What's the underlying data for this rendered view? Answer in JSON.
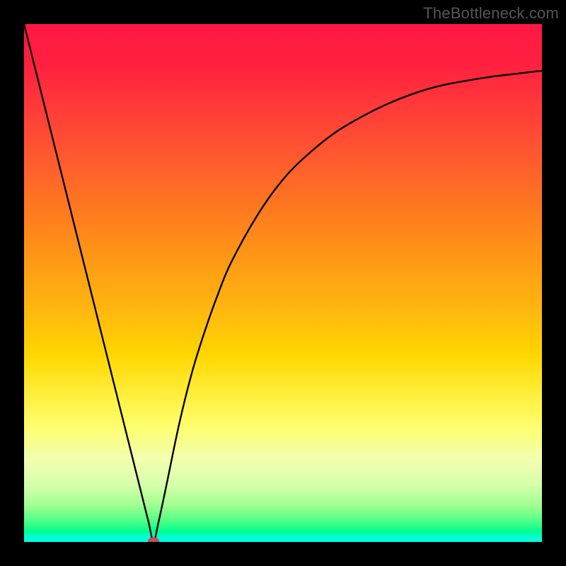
{
  "watermark": "TheBottleneck.com",
  "chart_data": {
    "type": "line",
    "title": "",
    "xlabel": "",
    "ylabel": "",
    "xlim": [
      0,
      1
    ],
    "ylim": [
      0,
      1
    ],
    "x": [
      0.0,
      0.025,
      0.05,
      0.075,
      0.1,
      0.125,
      0.15,
      0.175,
      0.2,
      0.225,
      0.24,
      0.25,
      0.26,
      0.275,
      0.3,
      0.325,
      0.35,
      0.375,
      0.4,
      0.45,
      0.5,
      0.55,
      0.6,
      0.65,
      0.7,
      0.75,
      0.8,
      0.85,
      0.9,
      0.95,
      1.0
    ],
    "y": [
      1.0,
      0.9,
      0.8,
      0.7,
      0.6,
      0.5,
      0.4,
      0.3,
      0.2,
      0.1,
      0.04,
      0.002,
      0.04,
      0.11,
      0.23,
      0.33,
      0.41,
      0.48,
      0.54,
      0.63,
      0.7,
      0.75,
      0.79,
      0.82,
      0.845,
      0.865,
      0.88,
      0.89,
      0.898,
      0.904,
      0.91
    ],
    "minimum_marker": {
      "x": 0.25,
      "y": 0.002,
      "color": "#cc4a55",
      "rx": 8,
      "ry": 5
    }
  },
  "colors": {
    "curve": "#000000",
    "frame": "#000000"
  }
}
